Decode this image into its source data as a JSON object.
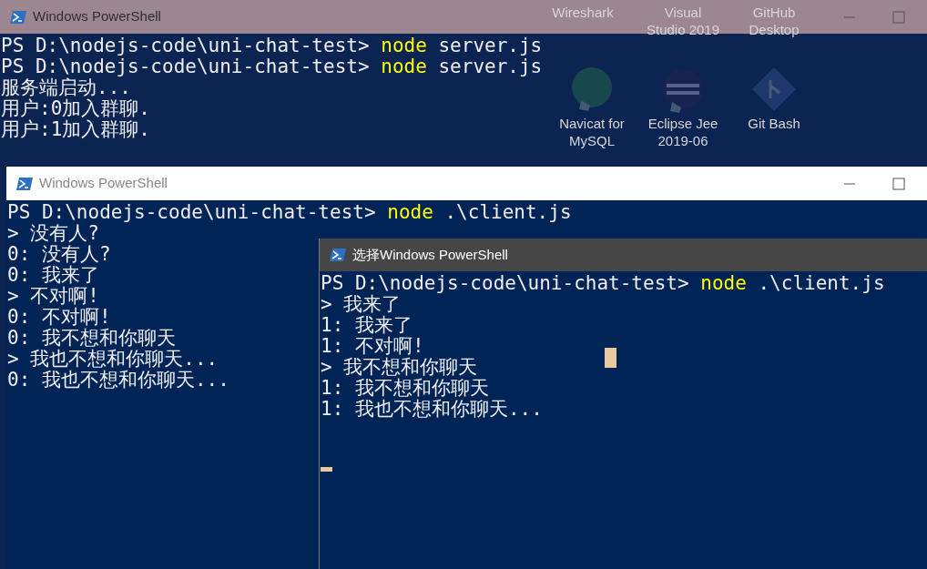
{
  "desktop_icons": [
    {
      "label": "Wireshark",
      "kind": "label_only"
    },
    {
      "label": "Visual Studio 2019",
      "kind": "label_only"
    },
    {
      "label": "GitHub Desktop",
      "kind": "label_only"
    },
    {
      "label": "Navicat for MySQL",
      "kind": "app"
    },
    {
      "label": "Eclipse Jee 2019-06",
      "kind": "app"
    },
    {
      "label": "Git Bash",
      "kind": "app"
    }
  ],
  "windows": [
    {
      "title": "Windows PowerShell",
      "focused": false,
      "lines": [
        {
          "kind": "prompt",
          "path": "PS D:\\nodejs-code\\uni-chat-test>",
          "command": "node",
          "args": "server.js"
        },
        {
          "kind": "prompt",
          "path": "PS D:\\nodejs-code\\uni-chat-test>",
          "command": "node",
          "args": "server.js"
        },
        {
          "kind": "output",
          "text": "服务端启动..."
        },
        {
          "kind": "output",
          "text": "用户:0加入群聊."
        },
        {
          "kind": "output",
          "text": "用户:1加入群聊."
        }
      ]
    },
    {
      "title": "Windows PowerShell",
      "focused": false,
      "lines": [
        {
          "kind": "prompt",
          "path": "PS D:\\nodejs-code\\uni-chat-test>",
          "command": "node",
          "args": ".\\client.js"
        },
        {
          "kind": "output",
          "text": "> 没有人?"
        },
        {
          "kind": "output",
          "text": "0: 没有人?"
        },
        {
          "kind": "output",
          "text": "0: 我来了"
        },
        {
          "kind": "output",
          "text": "> 不对啊!"
        },
        {
          "kind": "output",
          "text": "0: 不对啊!"
        },
        {
          "kind": "output",
          "text": "0: 我不想和你聊天"
        },
        {
          "kind": "output",
          "text": "> 我也不想和你聊天..."
        },
        {
          "kind": "output",
          "text": "0: 我也不想和你聊天..."
        }
      ]
    },
    {
      "title": "选择Windows PowerShell",
      "focused": true,
      "lines": [
        {
          "kind": "prompt",
          "path": "PS D:\\nodejs-code\\uni-chat-test>",
          "command": "node",
          "args": ".\\client.js"
        },
        {
          "kind": "output",
          "text": "> 我来了"
        },
        {
          "kind": "output",
          "text": "1: 我来了"
        },
        {
          "kind": "output",
          "text": "1: 不对啊!"
        },
        {
          "kind": "output",
          "text": "> 我不想和你聊天"
        },
        {
          "kind": "output",
          "text": "1: 我不想和你聊天"
        },
        {
          "kind": "output",
          "text": "1: 我也不想和你聊天..."
        }
      ]
    }
  ]
}
